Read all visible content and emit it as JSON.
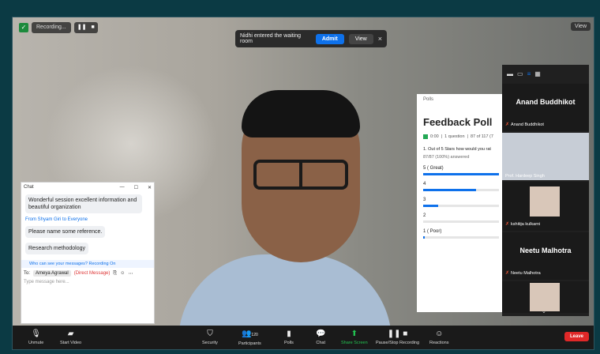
{
  "topbar": {
    "recording_label": "Recording...",
    "pause_icon": "pause-icon",
    "stop_icon": "stop-icon",
    "view_label": "View"
  },
  "notification": {
    "text": "Nidhi entered the waiting room",
    "admit": "Admit",
    "view": "View",
    "close": "×"
  },
  "chat": {
    "title": "Chat",
    "messages": [
      {
        "text": "Wonderful session excellent information and beautiful organization"
      },
      {
        "from": "From Shyam Giri to Everyone"
      },
      {
        "text": "Please name some reference."
      },
      {
        "text": "Research methodology"
      }
    ],
    "who_can_see": "Who can see your messages? Recording On",
    "to_label": "To:",
    "recipient": "Ameya Agrawal",
    "direct": "(Direct Message)",
    "placeholder": "Type message here..."
  },
  "poll": {
    "header": "Polls",
    "title": "Feedback Poll",
    "meta_time": "0:00",
    "meta_questions": "1 question",
    "meta_votes": "87 of 117 (7",
    "question": "1. Out of 5 Stars how would you rat",
    "answered": "87/87 (100%) answered",
    "options": [
      {
        "label": "5 ( Great)",
        "pct": 100
      },
      {
        "label": "4",
        "pct": 70
      },
      {
        "label": "3",
        "pct": 20
      },
      {
        "label": "2",
        "pct": 0
      },
      {
        "label": "1 ( Poor)",
        "pct": 2
      }
    ]
  },
  "gallery": {
    "tiles": [
      {
        "name": "Anand Buddhikot",
        "caption": "Anand Buddhikot"
      },
      {
        "caption": "Prof. Hardeep Singh"
      },
      {
        "caption": "kshitija kulkarni"
      },
      {
        "name": "Neetu Malhotra",
        "caption": "Neetu Malhotra"
      }
    ]
  },
  "toolbar": {
    "unmute": "Unmute",
    "start_video": "Start Video",
    "security": "Security",
    "participants": "Participants",
    "participants_count": "120",
    "polls": "Polls",
    "chat": "Chat",
    "share": "Share Screen",
    "record": "Pause/Stop Recording",
    "reactions": "Reactions",
    "leave": "Leave"
  },
  "colors": {
    "accent": "#0e71eb",
    "leave": "#e02828",
    "share": "#23c552"
  }
}
